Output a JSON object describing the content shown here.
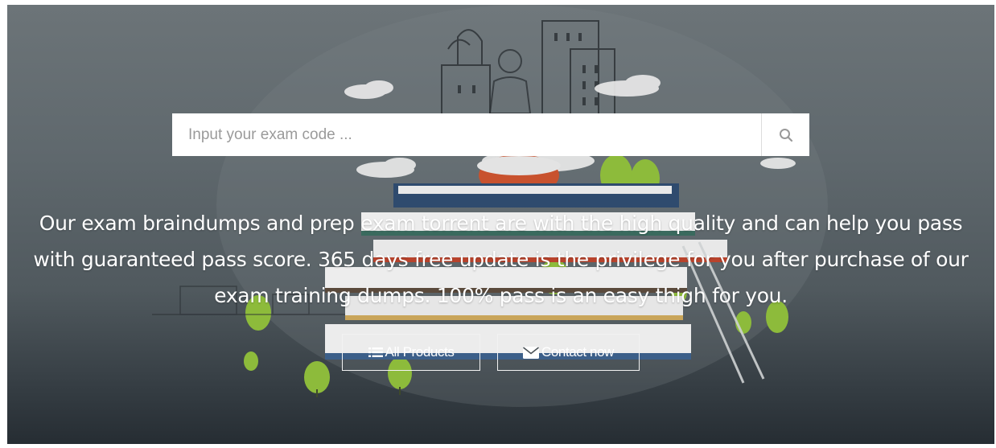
{
  "search": {
    "placeholder": "Input your exam code ...",
    "icon": "search-icon"
  },
  "hero": {
    "tagline": "Our exam braindumps and prep exam torrent are with the high quality and can help you pass with guaranteed pass score. 365 days free update is the privilege for you after purchase of our exam training dumps. 100% pass is an easy thigh for you."
  },
  "buttons": {
    "all_products": {
      "label": "All Products",
      "icon": "list-icon"
    },
    "contact_now": {
      "label": "Contact now",
      "icon": "envelope-icon"
    }
  },
  "colors": {
    "text": "#ffffff",
    "button_border": "#f2f2f2",
    "search_icon": "#999999"
  }
}
